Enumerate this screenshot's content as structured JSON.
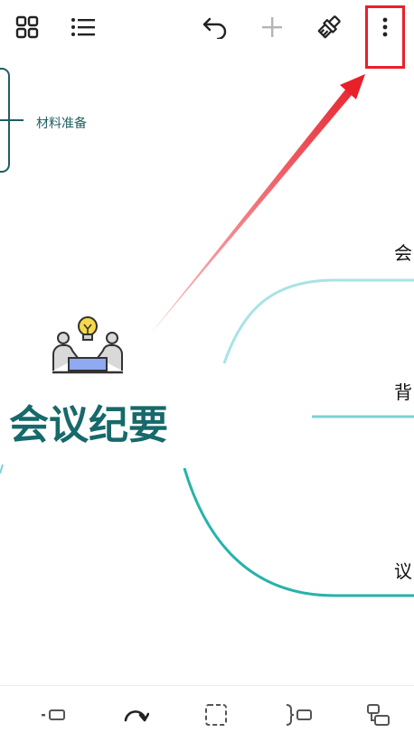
{
  "toolbar": {
    "icons": [
      "grid-icon",
      "outline-list-icon",
      "undo-icon",
      "add-icon",
      "format-brush-icon",
      "more-vert-icon"
    ]
  },
  "mindmap": {
    "central_topic": "会议纪要",
    "left_topic": "材料准备",
    "right_topics": [
      "会",
      "背",
      "议"
    ]
  },
  "bottombar": {
    "icons": [
      "insert-sibling-icon",
      "redo-curve-icon",
      "select-box-icon",
      "summary-icon",
      "insert-child-icon"
    ]
  },
  "colors": {
    "accent": "#17696b",
    "branch_light": "#a8e3e6",
    "branch_mid": "#7ad3d6",
    "branch_dark": "#26b3aa",
    "highlight": "#e8202a"
  }
}
